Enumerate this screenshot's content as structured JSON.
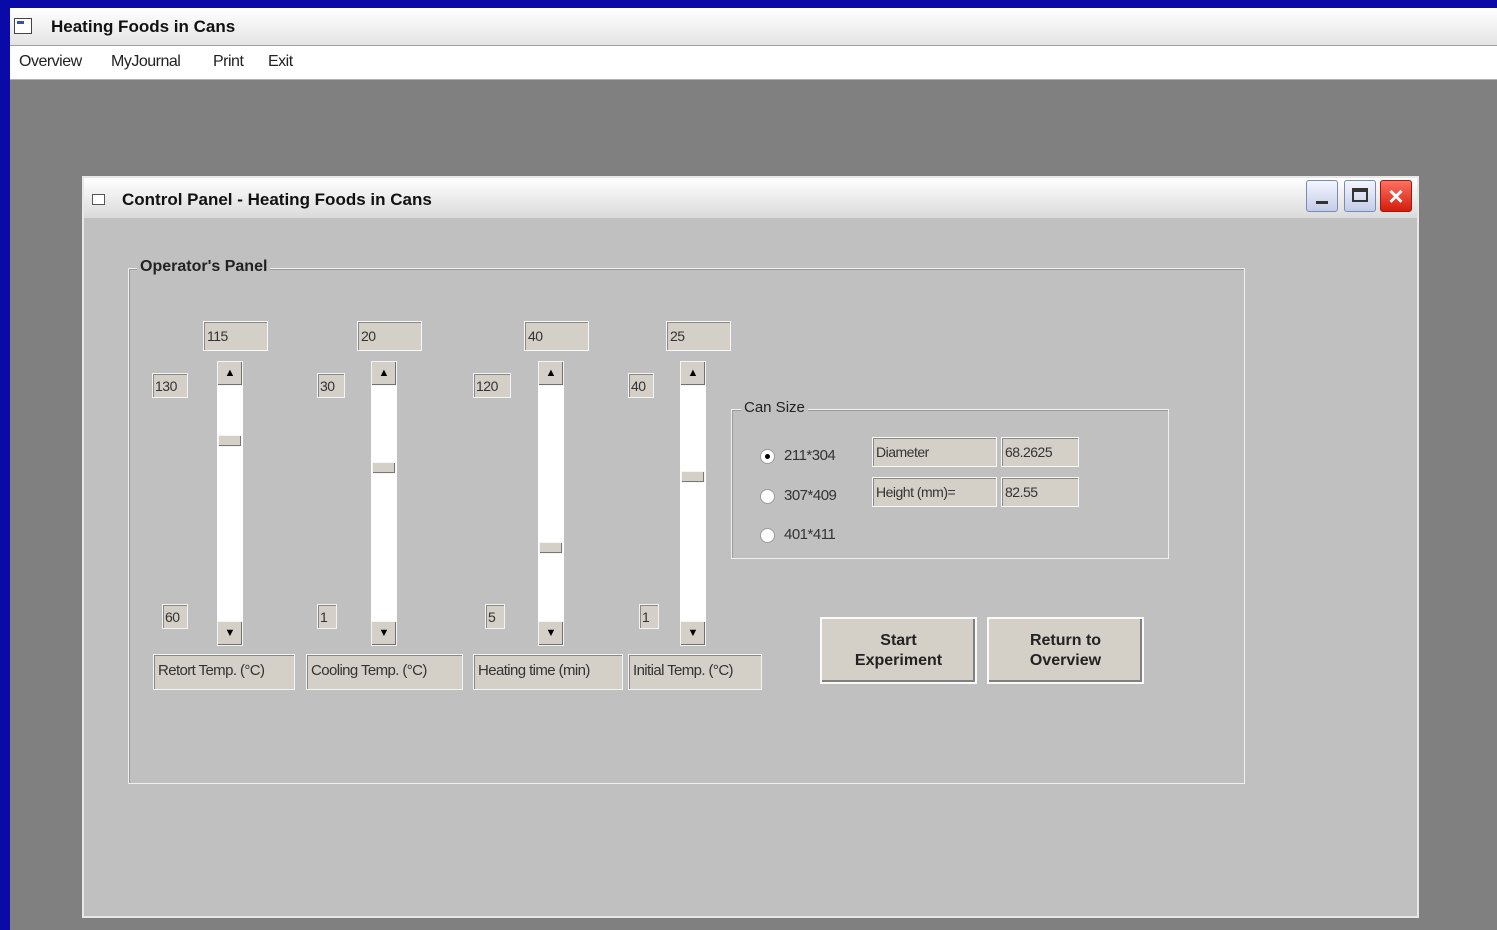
{
  "app": {
    "title": "Heating Foods in Cans",
    "menu": [
      "Overview",
      "MyJournal",
      "Print",
      "Exit"
    ]
  },
  "dialog": {
    "title": "Control Panel - Heating Foods in Cans",
    "operator_panel": {
      "label": "Operator's Panel",
      "controls": [
        {
          "value": "115",
          "max": "130",
          "min": "60",
          "caption": "Retort Temp. (°C)",
          "level_percent": 78
        },
        {
          "value": "20",
          "max": "30",
          "min": "1",
          "caption": "Cooling Temp. (°C)",
          "level_percent": 66
        },
        {
          "value": "40",
          "max": "120",
          "min": "5",
          "caption": "Heating time (min)",
          "level_percent": 30
        },
        {
          "value": "25",
          "max": "40",
          "min": "1",
          "caption": "Initial Temp. (°C)",
          "level_percent": 62
        }
      ]
    },
    "can_size": {
      "label": "Can Size",
      "options": [
        {
          "label": "211*304",
          "selected": true
        },
        {
          "label": "307*409",
          "selected": false
        },
        {
          "label": "401*411",
          "selected": false
        }
      ],
      "diameter_label": "Diameter",
      "diameter_value": "68.2625",
      "height_label": "Height (mm)=",
      "height_value": "82.55"
    },
    "buttons": {
      "start": "Start\nExperiment",
      "return": "Return to\nOverview"
    }
  }
}
